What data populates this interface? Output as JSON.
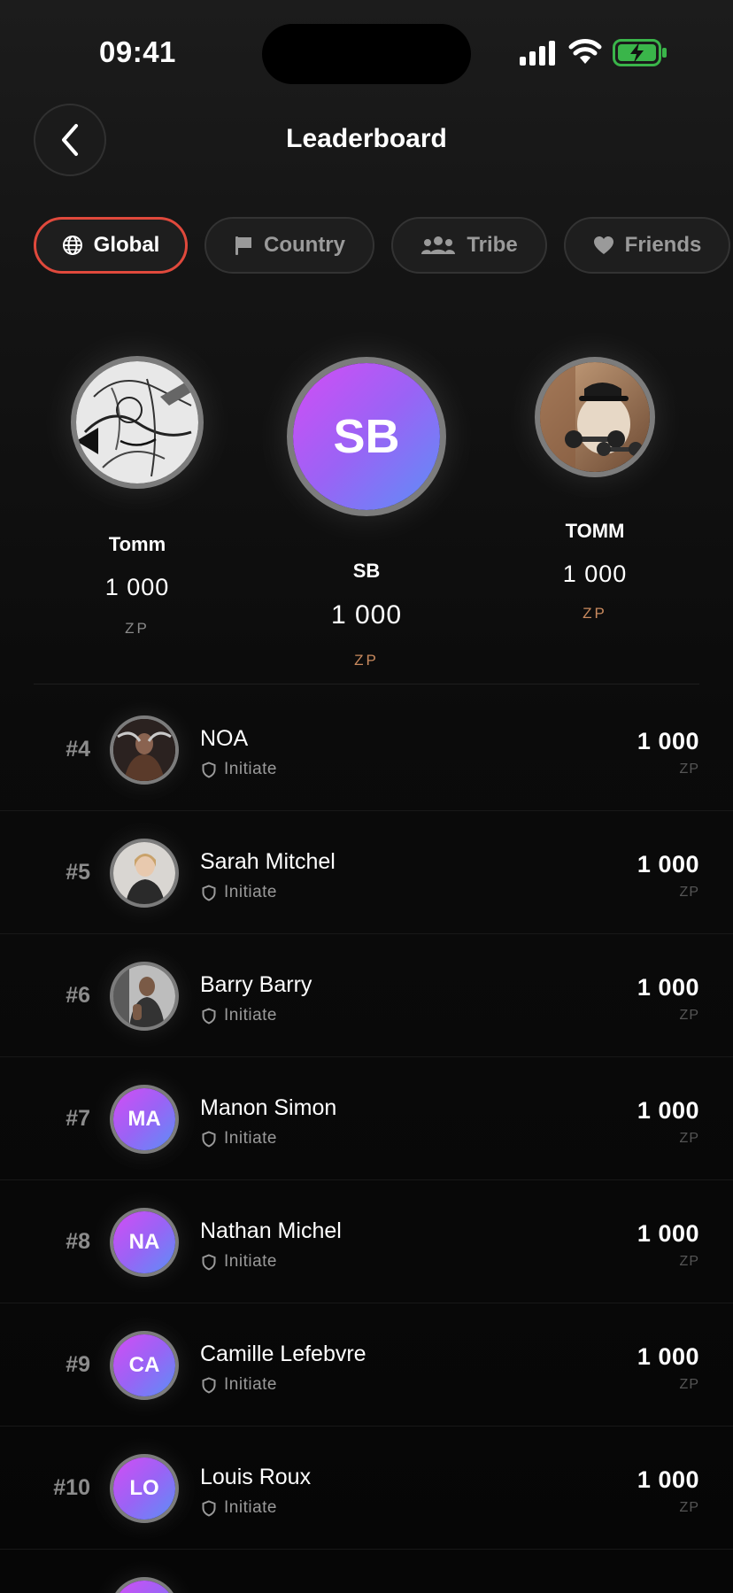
{
  "status": {
    "time": "09:41"
  },
  "header": {
    "title": "Leaderboard"
  },
  "tabs": [
    {
      "label": "Global",
      "icon": "globe-icon",
      "active": true
    },
    {
      "label": "Country",
      "icon": "flag-icon",
      "active": false
    },
    {
      "label": "Tribe",
      "icon": "group-icon",
      "active": false
    },
    {
      "label": "Friends",
      "icon": "heart-icon",
      "active": false
    }
  ],
  "podium": {
    "first": {
      "name": "SB",
      "initials": "SB",
      "score": "1 000",
      "unit": "ZP"
    },
    "second": {
      "name": "Tomm",
      "score": "1 000",
      "unit": "ZP",
      "avatar": "sketch-photo"
    },
    "third": {
      "name": "TOMM",
      "score": "1 000",
      "unit": "ZP",
      "avatar": "dumbbells-photo"
    }
  },
  "players": [
    {
      "rank": "#4",
      "name": "NOA",
      "badge": "Initiate",
      "score": "1 000",
      "unit": "ZP",
      "avatar": "photo"
    },
    {
      "rank": "#5",
      "name": "Sarah Mitchel",
      "badge": "Initiate",
      "score": "1 000",
      "unit": "ZP",
      "avatar": "photo"
    },
    {
      "rank": "#6",
      "name": "Barry Barry",
      "badge": "Initiate",
      "score": "1 000",
      "unit": "ZP",
      "avatar": "photo"
    },
    {
      "rank": "#7",
      "name": "Manon Simon",
      "badge": "Initiate",
      "score": "1 000",
      "unit": "ZP",
      "initials": "MA"
    },
    {
      "rank": "#8",
      "name": "Nathan Michel",
      "badge": "Initiate",
      "score": "1 000",
      "unit": "ZP",
      "initials": "NA"
    },
    {
      "rank": "#9",
      "name": "Camille Lefebvre",
      "badge": "Initiate",
      "score": "1 000",
      "unit": "ZP",
      "initials": "CA"
    },
    {
      "rank": "#10",
      "name": "Louis Roux",
      "badge": "Initiate",
      "score": "1 000",
      "unit": "ZP",
      "initials": "LO"
    }
  ],
  "colors": {
    "accent": "#e0493c",
    "gradient_start": "#d34df5",
    "gradient_end": "#5c8ff7",
    "unit_orange": "#c98a5e"
  }
}
